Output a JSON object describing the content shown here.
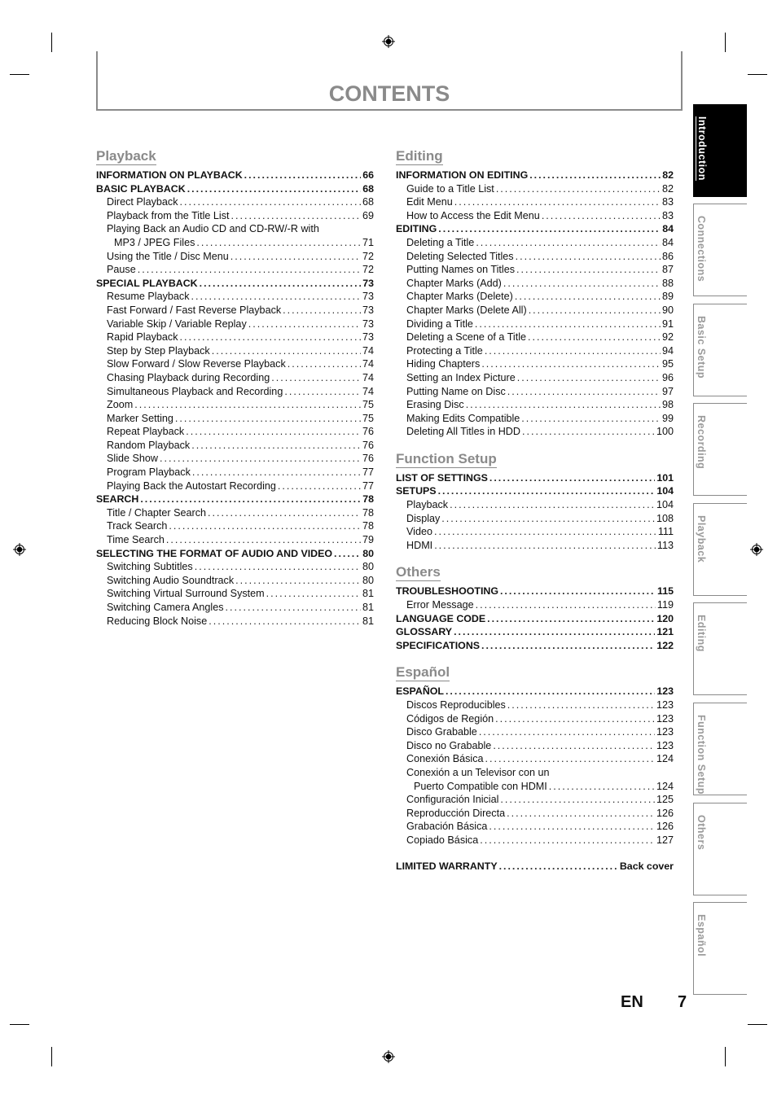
{
  "page": {
    "title": "CONTENTS",
    "language_code": "EN",
    "page_number": "7"
  },
  "side_tabs": [
    {
      "label": "Introduction",
      "active": true
    },
    {
      "label": "Connections",
      "active": false
    },
    {
      "label": "Basic Setup",
      "active": false
    },
    {
      "label": "Recording",
      "active": false
    },
    {
      "label": "Playback",
      "active": false
    },
    {
      "label": "Editing",
      "active": false
    },
    {
      "label": "Function Setup",
      "active": false
    },
    {
      "label": "Others",
      "active": false
    },
    {
      "label": "Español",
      "active": false
    }
  ],
  "left_column": [
    {
      "title": "Playback",
      "entries": [
        {
          "level": "major",
          "label": "INFORMATION ON PLAYBACK",
          "page": "66"
        },
        {
          "level": "major",
          "label": "BASIC PLAYBACK",
          "page": "68"
        },
        {
          "level": "minor",
          "label": "Direct Playback",
          "page": "68"
        },
        {
          "level": "minor",
          "label": "Playback from the Title List",
          "page": "69"
        },
        {
          "level": "wrap-head",
          "label": "Playing Back an Audio CD and CD-RW/-R with",
          "page": ""
        },
        {
          "level": "cont",
          "label": "MP3 / JPEG Files",
          "page": "71"
        },
        {
          "level": "minor",
          "label": "Using the Title / Disc Menu",
          "page": "72"
        },
        {
          "level": "minor",
          "label": "Pause",
          "page": "72"
        },
        {
          "level": "major",
          "label": "SPECIAL PLAYBACK",
          "page": "73"
        },
        {
          "level": "minor",
          "label": "Resume Playback",
          "page": "73"
        },
        {
          "level": "minor",
          "label": "Fast Forward / Fast Reverse Playback",
          "page": "73"
        },
        {
          "level": "minor",
          "label": "Variable Skip / Variable Replay",
          "page": "73"
        },
        {
          "level": "minor",
          "label": "Rapid Playback",
          "page": "73"
        },
        {
          "level": "minor",
          "label": "Step by Step Playback",
          "page": "74"
        },
        {
          "level": "minor",
          "label": "Slow Forward / Slow Reverse Playback",
          "page": "74"
        },
        {
          "level": "minor",
          "label": "Chasing Playback during Recording",
          "page": "74"
        },
        {
          "level": "minor",
          "label": "Simultaneous Playback and Recording",
          "page": "74"
        },
        {
          "level": "minor",
          "label": "Zoom",
          "page": "75"
        },
        {
          "level": "minor",
          "label": "Marker Setting",
          "page": "75"
        },
        {
          "level": "minor",
          "label": "Repeat Playback",
          "page": "76"
        },
        {
          "level": "minor",
          "label": "Random Playback",
          "page": "76"
        },
        {
          "level": "minor",
          "label": "Slide Show",
          "page": "76"
        },
        {
          "level": "minor",
          "label": "Program Playback",
          "page": "77"
        },
        {
          "level": "minor",
          "label": "Playing Back the Autostart Recording",
          "page": "77"
        },
        {
          "level": "major",
          "label": "SEARCH",
          "page": "78"
        },
        {
          "level": "minor",
          "label": "Title / Chapter Search",
          "page": "78"
        },
        {
          "level": "minor",
          "label": "Track Search",
          "page": "78"
        },
        {
          "level": "minor",
          "label": "Time Search",
          "page": "79"
        },
        {
          "level": "major",
          "label": "SELECTING THE FORMAT OF AUDIO AND VIDEO",
          "page": "80"
        },
        {
          "level": "minor",
          "label": "Switching Subtitles",
          "page": "80"
        },
        {
          "level": "minor",
          "label": "Switching Audio Soundtrack",
          "page": "80"
        },
        {
          "level": "minor",
          "label": "Switching Virtual Surround System",
          "page": "81"
        },
        {
          "level": "minor",
          "label": "Switching Camera Angles",
          "page": "81"
        },
        {
          "level": "minor",
          "label": "Reducing Block Noise",
          "page": "81"
        }
      ]
    }
  ],
  "right_column": [
    {
      "title": "Editing",
      "entries": [
        {
          "level": "major",
          "label": "INFORMATION ON EDITING",
          "page": "82"
        },
        {
          "level": "minor",
          "label": "Guide to a Title List",
          "page": "82"
        },
        {
          "level": "minor",
          "label": "Edit Menu",
          "page": "83"
        },
        {
          "level": "minor",
          "label": "How to Access the Edit Menu",
          "page": "83"
        },
        {
          "level": "major",
          "label": "EDITING",
          "page": "84"
        },
        {
          "level": "minor",
          "label": "Deleting a Title",
          "page": "84"
        },
        {
          "level": "minor",
          "label": "Deleting Selected Titles",
          "page": "86"
        },
        {
          "level": "minor",
          "label": "Putting Names on Titles",
          "page": "87"
        },
        {
          "level": "minor",
          "label": "Chapter Marks (Add)",
          "page": "88"
        },
        {
          "level": "minor",
          "label": "Chapter Marks (Delete)",
          "page": "89"
        },
        {
          "level": "minor",
          "label": "Chapter Marks (Delete All)",
          "page": "90"
        },
        {
          "level": "minor",
          "label": "Dividing a Title",
          "page": "91"
        },
        {
          "level": "minor",
          "label": "Deleting a Scene of a Title",
          "page": "92"
        },
        {
          "level": "minor",
          "label": "Protecting a Title",
          "page": "94"
        },
        {
          "level": "minor",
          "label": "Hiding Chapters",
          "page": "95"
        },
        {
          "level": "minor",
          "label": "Setting an Index Picture",
          "page": "96"
        },
        {
          "level": "minor",
          "label": "Putting Name on Disc",
          "page": "97"
        },
        {
          "level": "minor",
          "label": "Erasing Disc",
          "page": "98"
        },
        {
          "level": "minor",
          "label": "Making Edits Compatible",
          "page": "99"
        },
        {
          "level": "minor",
          "label": "Deleting All Titles in HDD",
          "page": "100"
        }
      ]
    },
    {
      "title": "Function Setup",
      "entries": [
        {
          "level": "major",
          "label": "LIST OF SETTINGS",
          "page": "101"
        },
        {
          "level": "major",
          "label": "SETUPS",
          "page": "104"
        },
        {
          "level": "minor",
          "label": "Playback",
          "page": "104"
        },
        {
          "level": "minor",
          "label": "Display",
          "page": "108"
        },
        {
          "level": "minor",
          "label": "Video",
          "page": "111"
        },
        {
          "level": "minor",
          "label": "HDMI",
          "page": "113"
        }
      ]
    },
    {
      "title": "Others",
      "entries": [
        {
          "level": "major",
          "label": "TROUBLESHOOTING",
          "page": "115"
        },
        {
          "level": "minor",
          "label": "Error Message",
          "page": "119"
        },
        {
          "level": "major",
          "label": "LANGUAGE CODE",
          "page": "120"
        },
        {
          "level": "major",
          "label": "GLOSSARY",
          "page": "121"
        },
        {
          "level": "major",
          "label": "SPECIFICATIONS",
          "page": "122"
        }
      ]
    },
    {
      "title": "Español",
      "entries": [
        {
          "level": "major",
          "label": "ESPAÑOL",
          "page": "123"
        },
        {
          "level": "minor",
          "label": "Discos Reproducibles",
          "page": "123"
        },
        {
          "level": "minor",
          "label": "Códigos de Región",
          "page": "123"
        },
        {
          "level": "minor",
          "label": "Disco Grabable",
          "page": "123"
        },
        {
          "level": "minor",
          "label": "Disco no Grabable",
          "page": "123"
        },
        {
          "level": "minor",
          "label": "Conexión Básica",
          "page": "124"
        },
        {
          "level": "wrap-head",
          "label": "Conexión a un Televisor con un",
          "page": ""
        },
        {
          "level": "cont",
          "label": "Puerto Compatible con HDMI",
          "page": "124"
        },
        {
          "level": "minor",
          "label": "Configuración Inicial",
          "page": "125"
        },
        {
          "level": "minor",
          "label": "Reproducción Directa",
          "page": "126"
        },
        {
          "level": "minor",
          "label": "Grabación Básica",
          "page": "126"
        },
        {
          "level": "minor",
          "label": "Copiado Básica",
          "page": "127"
        }
      ]
    }
  ],
  "warranty": {
    "label": "LIMITED WARRANTY",
    "page": "Back cover"
  },
  "icons": {
    "registration_mark": "crosshair-target-icon"
  }
}
